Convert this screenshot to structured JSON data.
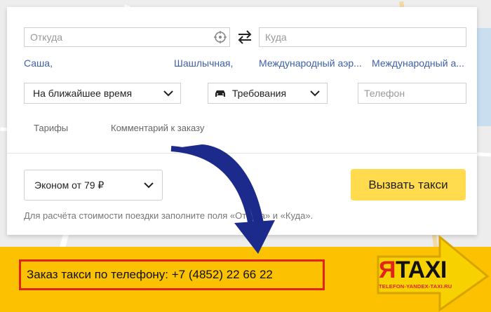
{
  "form": {
    "from_placeholder": "Откуда",
    "to_placeholder": "Куда",
    "suggestions": [
      "Саша,",
      "Шашлычная,",
      "Международный аэр...",
      "Международный а..."
    ],
    "time_select": "На ближайшее время",
    "requirements_select": "Требования",
    "phone_placeholder": "Телефон",
    "tabs": [
      "Тарифы",
      "Комментарий к заказу"
    ],
    "tariff_select": "Эконом от 79 ₽",
    "call_button": "Вызвать такси",
    "hint": "Для расчёта стоимости поездки заполните поля «Откуда» и «Куда»."
  },
  "banner": {
    "phone_text": "Заказ такси по телефону: +7 (4852) 22 66 22",
    "logo_ya": "Я",
    "logo_taxi": "TAXI",
    "logo_site": "TELEFON-YANDEX-TAXI.RU"
  },
  "colors": {
    "accent_yellow": "#ffdb4d",
    "banner_yellow": "#fcc100",
    "border_red": "#e2231a",
    "link_blue": "#3d5fa8",
    "arrow_blue": "#1c2a8c"
  }
}
